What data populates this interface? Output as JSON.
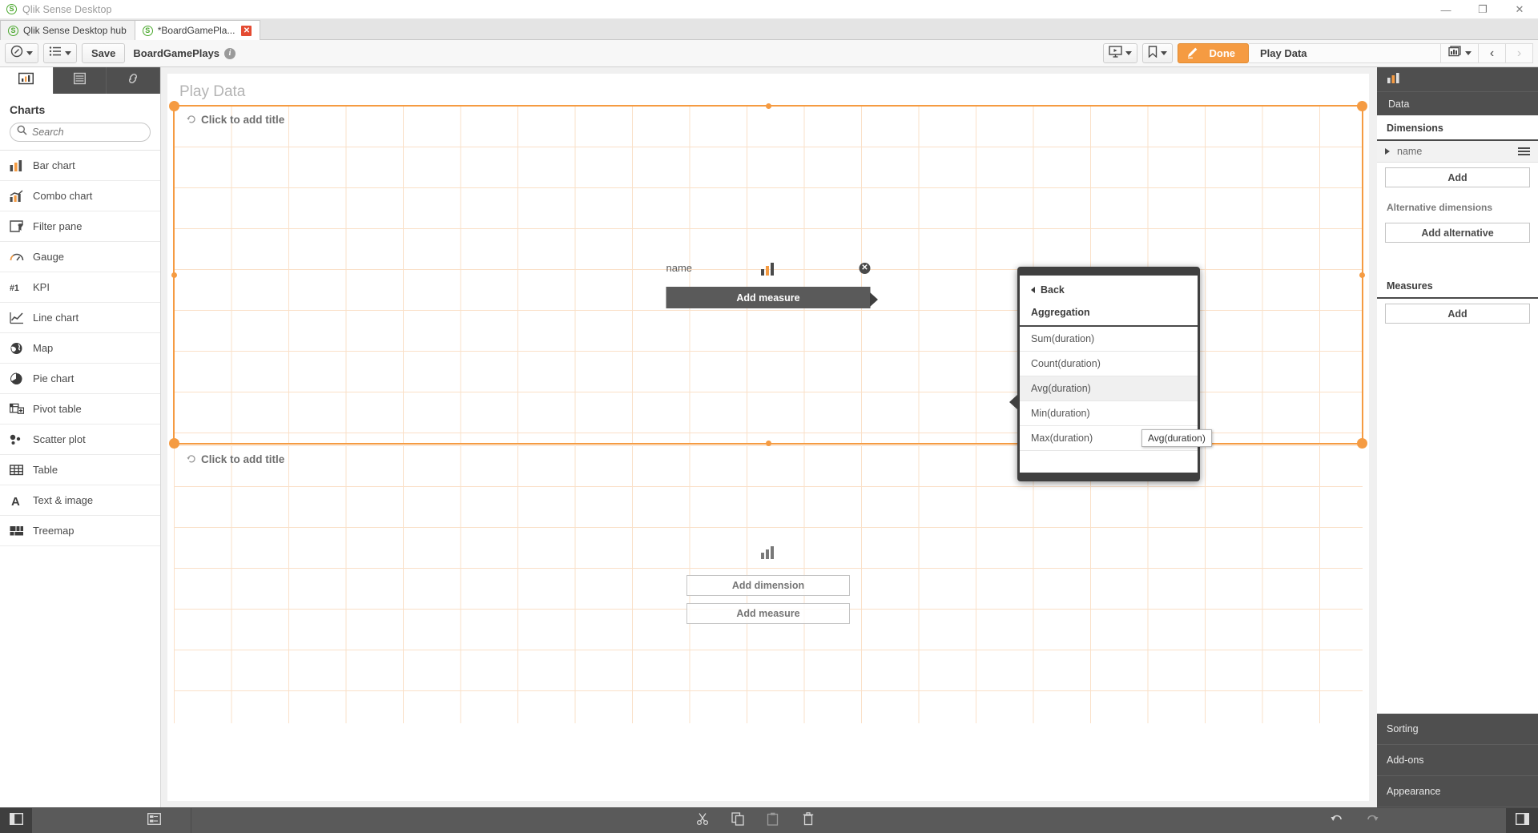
{
  "window": {
    "title": "Qlik Sense Desktop",
    "minimize_label": "—",
    "maximize_label": "❐",
    "close_label": "✕"
  },
  "tabs": [
    {
      "label": "Qlik Sense Desktop hub",
      "active": false,
      "closable": false
    },
    {
      "label": "*BoardGamePla...",
      "active": true,
      "closable": true,
      "close_label": "✕"
    }
  ],
  "toolbar": {
    "navigation_icon": "compass-icon",
    "sheets_icon": "list-icon",
    "save_label": "Save",
    "app_name": "BoardGamePlays",
    "info_label": "i",
    "present_icon": "presentation-icon",
    "bookmark_icon": "bookmark-icon",
    "done_label": "Done",
    "edit_icon": "pencil-icon",
    "sheet_name": "Play Data",
    "sheet_picker_icon": "sheet-grid-icon",
    "prev_label": "‹",
    "next_label": "›"
  },
  "left_panel": {
    "tabs": [
      {
        "name": "charts-tab",
        "icon": "bar-chart-icon",
        "active": true
      },
      {
        "name": "fields-tab",
        "icon": "table-rows-icon",
        "active": false
      },
      {
        "name": "master-items-tab",
        "icon": "link-icon",
        "active": false
      }
    ],
    "header": "Charts",
    "search": {
      "placeholder": "Search",
      "value": "",
      "icon": "search-icon"
    },
    "items": [
      {
        "label": "Bar chart",
        "icon": "bar-chart-icon"
      },
      {
        "label": "Combo chart",
        "icon": "combo-chart-icon"
      },
      {
        "label": "Filter pane",
        "icon": "filter-pane-icon"
      },
      {
        "label": "Gauge",
        "icon": "gauge-icon"
      },
      {
        "label": "KPI",
        "icon": "kpi-icon"
      },
      {
        "label": "Line chart",
        "icon": "line-chart-icon"
      },
      {
        "label": "Map",
        "icon": "map-icon"
      },
      {
        "label": "Pie chart",
        "icon": "pie-chart-icon"
      },
      {
        "label": "Pivot table",
        "icon": "pivot-table-icon"
      },
      {
        "label": "Scatter plot",
        "icon": "scatter-plot-icon"
      },
      {
        "label": "Table",
        "icon": "table-icon"
      },
      {
        "label": "Text & image",
        "icon": "text-image-icon"
      },
      {
        "label": "Treemap",
        "icon": "treemap-icon"
      }
    ]
  },
  "canvas": {
    "sheet_title": "Play Data",
    "objects": [
      {
        "title": "Click to add title",
        "selected": true,
        "dimension_label": "name",
        "remove_icon_label": "✕",
        "add_measure_label": "Add measure",
        "placeholder_icon": "bar-chart-icon"
      },
      {
        "title": "Click to add title",
        "selected": false,
        "add_dimension_label": "Add dimension",
        "add_measure_label": "Add measure",
        "placeholder_icon": "bar-chart-icon"
      }
    ]
  },
  "aggregation_popup": {
    "back_label": "Back",
    "section_title": "Aggregation",
    "options": [
      {
        "label": "Sum(duration)",
        "highlighted": false
      },
      {
        "label": "Count(duration)",
        "highlighted": false
      },
      {
        "label": "Avg(duration)",
        "highlighted": true
      },
      {
        "label": "Min(duration)",
        "highlighted": false
      },
      {
        "label": "Max(duration)",
        "highlighted": false
      }
    ],
    "tooltip": "Avg(duration)"
  },
  "right_panel": {
    "chart_type_icon": "bar-chart-icon",
    "data_tab": "Data",
    "dimensions_label": "Dimensions",
    "dimension_field": "name",
    "dimensions_add": "Add",
    "alternative_dimensions_label": "Alternative dimensions",
    "add_alternative": "Add alternative",
    "measures_label": "Measures",
    "measures_add": "Add",
    "accordions": [
      {
        "label": "Sorting"
      },
      {
        "label": "Add-ons"
      },
      {
        "label": "Appearance"
      }
    ]
  },
  "status_bar": {
    "left_toggle_icon": "panel-left-icon",
    "data_model_icon": "data-model-icon",
    "cut_icon": "scissors-icon",
    "copy_icon": "copy-icon",
    "paste_icon": "paste-icon",
    "delete_icon": "trash-icon",
    "undo_icon": "undo-icon",
    "redo_icon": "redo-icon",
    "right_toggle_icon": "panel-right-icon"
  },
  "colors": {
    "accent": "#f59b42",
    "dark_panel": "#4f4f4f",
    "grid_line": "#fae0c8"
  }
}
